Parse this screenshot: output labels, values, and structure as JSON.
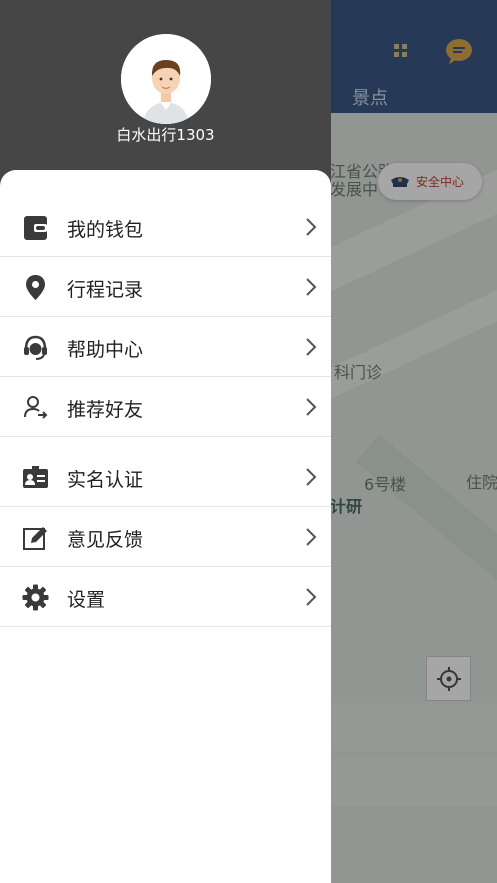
{
  "user": {
    "name": "白水出行1303"
  },
  "menu": [
    {
      "label": "我的钱包",
      "icon": "wallet-icon"
    },
    {
      "label": "行程记录",
      "icon": "location-pin-icon"
    },
    {
      "label": "帮助中心",
      "icon": "headset-icon"
    },
    {
      "label": "推荐好友",
      "icon": "user-share-icon"
    },
    {
      "label": "实名认证",
      "icon": "id-card-icon"
    },
    {
      "label": "意见反馈",
      "icon": "pencil-icon"
    },
    {
      "label": "设置",
      "icon": "gear-icon"
    }
  ],
  "background": {
    "tab_label": "景点",
    "safety_center": "安全中心",
    "map_labels": [
      "江省公路",
      "发展中",
      "科门诊",
      "6号楼",
      "住院",
      "计研"
    ]
  },
  "colors": {
    "drawer_header": "#464646",
    "app_header": "#3b5a86",
    "safety_text": "#c64135"
  }
}
